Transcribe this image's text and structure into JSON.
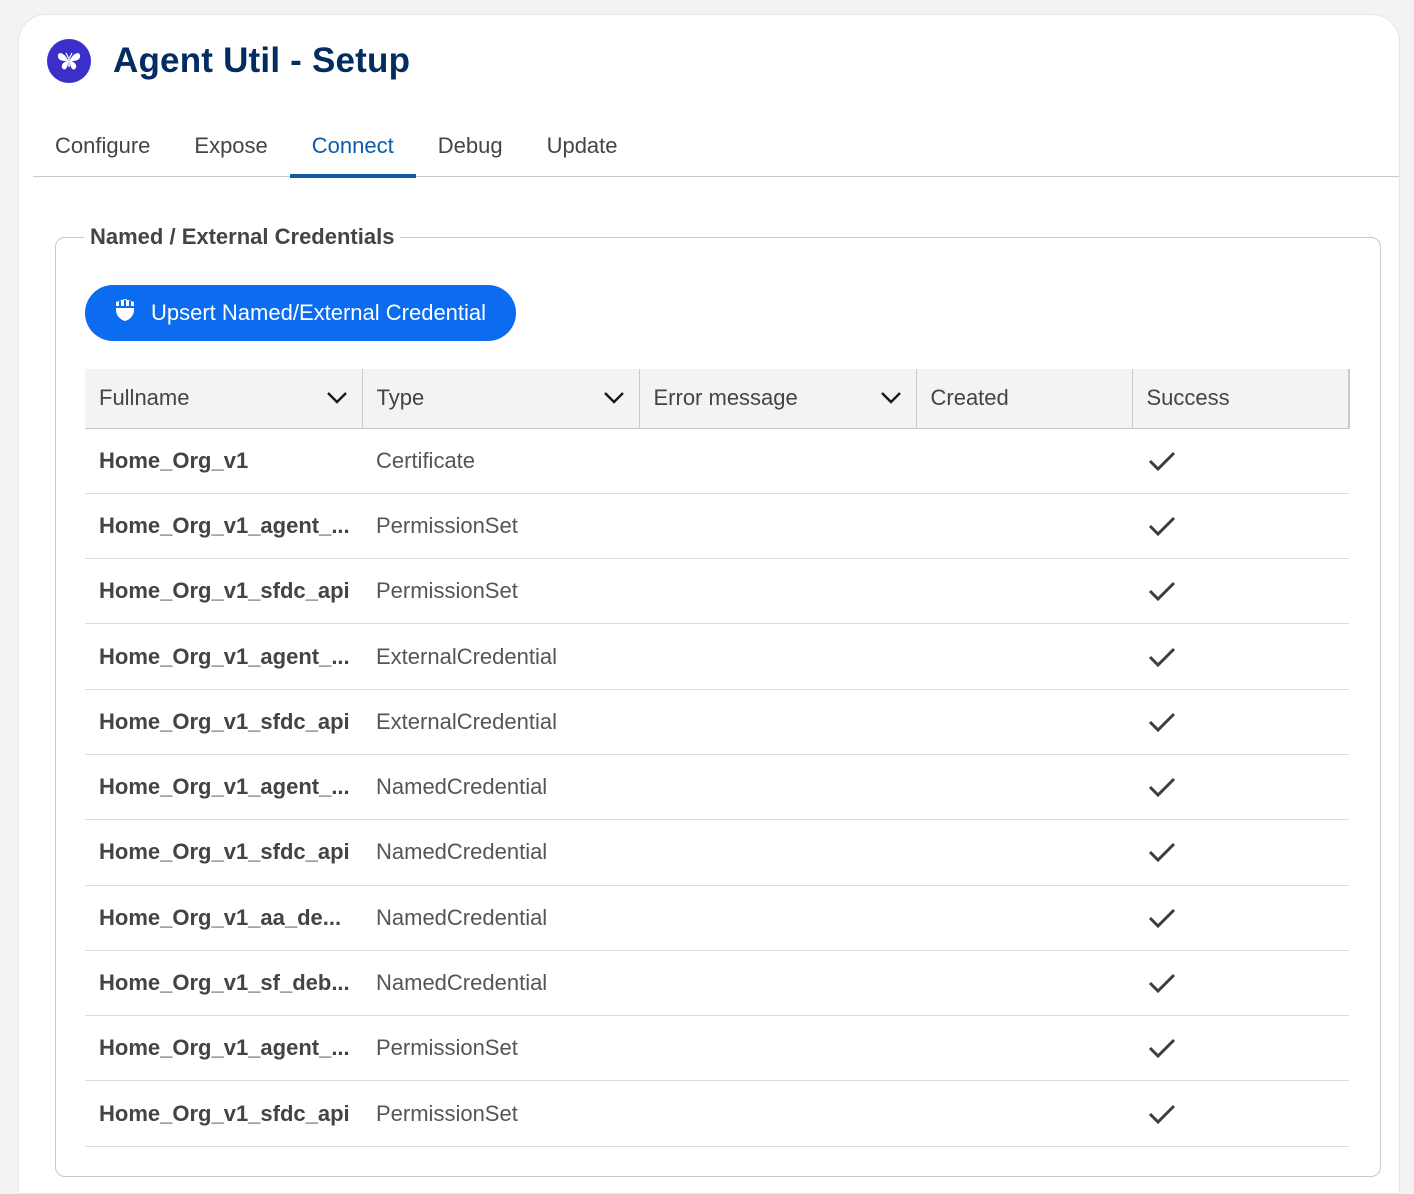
{
  "app": {
    "title": "Agent Util - Setup",
    "accent_color": "#0b5cab",
    "icon": "butterfly-icon"
  },
  "tabs": [
    {
      "label": "Configure",
      "active": false
    },
    {
      "label": "Expose",
      "active": false
    },
    {
      "label": "Connect",
      "active": true
    },
    {
      "label": "Debug",
      "active": false
    },
    {
      "label": "Update",
      "active": false
    }
  ],
  "section": {
    "title": "Named / External Credentials",
    "button_label": "Upsert Named/External Credential",
    "button_icon": "shield-icon",
    "button_color": "#0b6cf0"
  },
  "table": {
    "columns": [
      {
        "label": "Fullname",
        "sortable": true
      },
      {
        "label": "Type",
        "sortable": true
      },
      {
        "label": "Error message",
        "sortable": true
      },
      {
        "label": "Created",
        "sortable": false
      },
      {
        "label": "Success",
        "sortable": false
      }
    ],
    "rows": [
      {
        "fullname": "Home_Org_v1",
        "type": "Certificate",
        "error": "",
        "created": "",
        "success": true
      },
      {
        "fullname": "Home_Org_v1_agent_...",
        "type": "PermissionSet",
        "error": "",
        "created": "",
        "success": true
      },
      {
        "fullname": "Home_Org_v1_sfdc_api",
        "type": "PermissionSet",
        "error": "",
        "created": "",
        "success": true
      },
      {
        "fullname": "Home_Org_v1_agent_...",
        "type": "ExternalCredential",
        "error": "",
        "created": "",
        "success": true
      },
      {
        "fullname": "Home_Org_v1_sfdc_api",
        "type": "ExternalCredential",
        "error": "",
        "created": "",
        "success": true
      },
      {
        "fullname": "Home_Org_v1_agent_...",
        "type": "NamedCredential",
        "error": "",
        "created": "",
        "success": true
      },
      {
        "fullname": "Home_Org_v1_sfdc_api",
        "type": "NamedCredential",
        "error": "",
        "created": "",
        "success": true
      },
      {
        "fullname": "Home_Org_v1_aa_de...",
        "type": "NamedCredential",
        "error": "",
        "created": "",
        "success": true
      },
      {
        "fullname": "Home_Org_v1_sf_deb...",
        "type": "NamedCredential",
        "error": "",
        "created": "",
        "success": true
      },
      {
        "fullname": "Home_Org_v1_agent_...",
        "type": "PermissionSet",
        "error": "",
        "created": "",
        "success": true
      },
      {
        "fullname": "Home_Org_v1_sfdc_api",
        "type": "PermissionSet",
        "error": "",
        "created": "",
        "success": true
      }
    ]
  }
}
